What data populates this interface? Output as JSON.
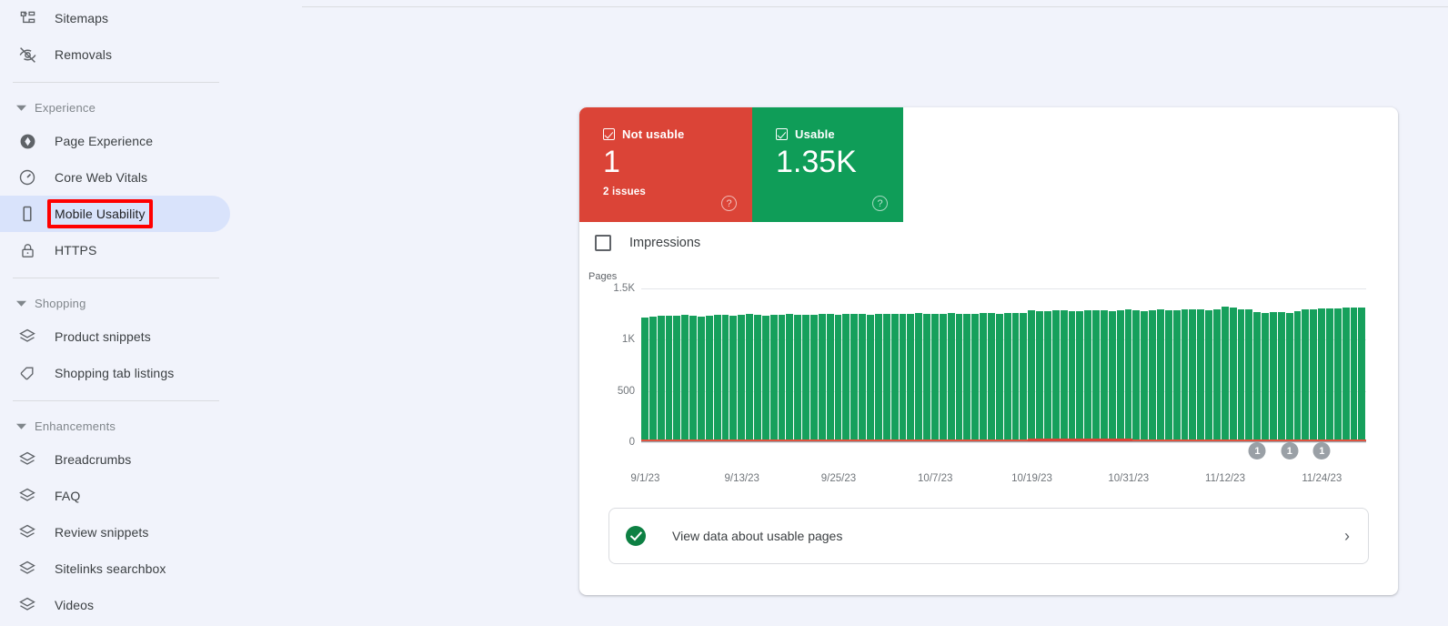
{
  "sidebar": {
    "groups": [
      {
        "type": "items",
        "items": [
          {
            "label": "Sitemaps",
            "icon": "sitemap-icon",
            "selected": false
          },
          {
            "label": "Removals",
            "icon": "eye-off-icon",
            "selected": false
          }
        ]
      },
      {
        "type": "section",
        "title": "Experience",
        "items": [
          {
            "label": "Page Experience",
            "icon": "page-experience-icon",
            "selected": false
          },
          {
            "label": "Core Web Vitals",
            "icon": "speedometer-icon",
            "selected": false
          },
          {
            "label": "Mobile Usability",
            "icon": "mobile-phone-icon",
            "selected": true
          },
          {
            "label": "HTTPS",
            "icon": "lock-icon",
            "selected": false
          }
        ]
      },
      {
        "type": "section",
        "title": "Shopping",
        "items": [
          {
            "label": "Product snippets",
            "icon": "layers-icon",
            "selected": false
          },
          {
            "label": "Shopping tab listings",
            "icon": "tag-icon",
            "selected": false
          }
        ]
      },
      {
        "type": "section",
        "title": "Enhancements",
        "items": [
          {
            "label": "Breadcrumbs",
            "icon": "layers-icon",
            "selected": false
          },
          {
            "label": "FAQ",
            "icon": "layers-icon",
            "selected": false
          },
          {
            "label": "Review snippets",
            "icon": "layers-icon",
            "selected": false
          },
          {
            "label": "Sitelinks searchbox",
            "icon": "layers-icon",
            "selected": false
          },
          {
            "label": "Videos",
            "icon": "layers-icon",
            "selected": false
          }
        ]
      }
    ]
  },
  "tiles": [
    {
      "key": "not-usable",
      "label": "Not usable",
      "value": "1",
      "sub": "2 issues",
      "color": "#db4437",
      "checked": true,
      "help": "?"
    },
    {
      "key": "usable",
      "label": "Usable",
      "value": "1.35K",
      "sub": "",
      "color": "#0f9d58",
      "checked": true,
      "help": "?"
    }
  ],
  "impressions": {
    "label": "Impressions",
    "checked": false
  },
  "footer": {
    "label": "View data about usable pages",
    "chevron": "›"
  },
  "chart_data": {
    "type": "bar",
    "title": "",
    "ylabel": "Pages",
    "xlabel": "",
    "ylim": [
      0,
      1500
    ],
    "yticks": [
      0,
      500,
      1000,
      1500
    ],
    "ytick_labels": [
      "0",
      "500",
      "1K",
      "1.5K"
    ],
    "grid": true,
    "legend_position": "top",
    "xtick_labels": [
      "9/1/23",
      "9/13/23",
      "9/25/23",
      "10/7/23",
      "10/19/23",
      "10/31/23",
      "11/12/23",
      "11/24/23"
    ],
    "xtick_indices": [
      0,
      12,
      24,
      36,
      48,
      60,
      72,
      84
    ],
    "x_start": "9/1/23",
    "x_end": "11/29/23",
    "series": [
      {
        "name": "Usable",
        "color": "#16a05c",
        "values": [
          1215,
          1228,
          1232,
          1235,
          1238,
          1240,
          1236,
          1228,
          1234,
          1240,
          1242,
          1238,
          1244,
          1248,
          1240,
          1236,
          1242,
          1246,
          1250,
          1244,
          1240,
          1246,
          1252,
          1248,
          1244,
          1250,
          1254,
          1248,
          1244,
          1250,
          1256,
          1252,
          1248,
          1254,
          1258,
          1252,
          1248,
          1254,
          1260,
          1256,
          1250,
          1256,
          1262,
          1258,
          1252,
          1258,
          1264,
          1260,
          1285,
          1282,
          1278,
          1284,
          1288,
          1282,
          1278,
          1284,
          1290,
          1286,
          1280,
          1286,
          1292,
          1288,
          1282,
          1288,
          1294,
          1290,
          1286,
          1292,
          1298,
          1294,
          1288,
          1294,
          1320,
          1310,
          1300,
          1294,
          1268,
          1262,
          1266,
          1270,
          1264,
          1276,
          1292,
          1300,
          1306,
          1302,
          1308,
          1312,
          1316,
          1318
        ]
      },
      {
        "name": "Not usable",
        "color": "#db4437",
        "values": [
          1,
          1,
          1,
          1,
          1,
          1,
          1,
          1,
          1,
          1,
          1,
          1,
          1,
          1,
          1,
          1,
          1,
          1,
          1,
          1,
          1,
          1,
          1,
          1,
          1,
          1,
          1,
          1,
          1,
          1,
          1,
          1,
          1,
          1,
          1,
          1,
          1,
          1,
          1,
          1,
          1,
          1,
          1,
          1,
          1,
          1,
          1,
          1,
          3,
          3,
          3,
          3,
          3,
          3,
          3,
          3,
          3,
          3,
          3,
          3,
          3,
          1,
          1,
          1,
          1,
          1,
          1,
          1,
          1,
          1,
          1,
          1,
          1,
          1,
          1,
          1,
          1,
          1,
          1,
          1,
          1,
          1,
          1,
          1,
          1,
          1,
          1,
          1,
          1,
          1
        ]
      }
    ],
    "annotations": [
      {
        "index": 76,
        "label": "1"
      },
      {
        "index": 80,
        "label": "1"
      },
      {
        "index": 84,
        "label": "1"
      }
    ]
  }
}
